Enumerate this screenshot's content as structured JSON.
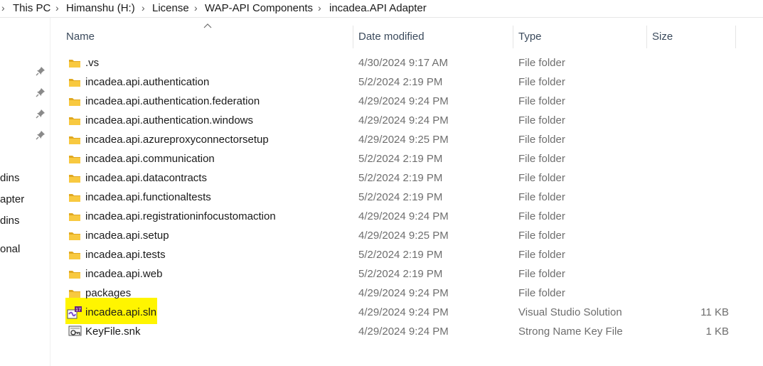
{
  "breadcrumb": {
    "items": [
      "This PC",
      "Himanshu (H:)",
      "License",
      "WAP-API Components",
      "incadea.API Adapter"
    ]
  },
  "nav_pane": {
    "labels": [
      "dins",
      "apter",
      "dins",
      "onal"
    ]
  },
  "columns": {
    "name": "Name",
    "date_modified": "Date modified",
    "type": "Type",
    "size": "Size"
  },
  "files": [
    {
      "name": ".vs",
      "date": "4/30/2024 9:17 AM",
      "type": "File folder",
      "size": "",
      "icon": "folder-icon"
    },
    {
      "name": "incadea.api.authentication",
      "date": "5/2/2024 2:19 PM",
      "type": "File folder",
      "size": "",
      "icon": "folder-icon"
    },
    {
      "name": "incadea.api.authentication.federation",
      "date": "4/29/2024 9:24 PM",
      "type": "File folder",
      "size": "",
      "icon": "folder-icon"
    },
    {
      "name": "incadea.api.authentication.windows",
      "date": "4/29/2024 9:24 PM",
      "type": "File folder",
      "size": "",
      "icon": "folder-icon"
    },
    {
      "name": "incadea.api.azureproxyconnectorsetup",
      "date": "4/29/2024 9:25 PM",
      "type": "File folder",
      "size": "",
      "icon": "folder-icon"
    },
    {
      "name": "incadea.api.communication",
      "date": "5/2/2024 2:19 PM",
      "type": "File folder",
      "size": "",
      "icon": "folder-icon"
    },
    {
      "name": "incadea.api.datacontracts",
      "date": "5/2/2024 2:19 PM",
      "type": "File folder",
      "size": "",
      "icon": "folder-icon"
    },
    {
      "name": "incadea.api.functionaltests",
      "date": "5/2/2024 2:19 PM",
      "type": "File folder",
      "size": "",
      "icon": "folder-icon"
    },
    {
      "name": "incadea.api.registrationinfocustomaction",
      "date": "4/29/2024 9:24 PM",
      "type": "File folder",
      "size": "",
      "icon": "folder-icon"
    },
    {
      "name": "incadea.api.setup",
      "date": "4/29/2024 9:25 PM",
      "type": "File folder",
      "size": "",
      "icon": "folder-icon"
    },
    {
      "name": "incadea.api.tests",
      "date": "5/2/2024 2:19 PM",
      "type": "File folder",
      "size": "",
      "icon": "folder-icon"
    },
    {
      "name": "incadea.api.web",
      "date": "5/2/2024 2:19 PM",
      "type": "File folder",
      "size": "",
      "icon": "folder-icon"
    },
    {
      "name": "packages",
      "date": "4/29/2024 9:24 PM",
      "type": "File folder",
      "size": "",
      "icon": "folder-icon"
    },
    {
      "name": "incadea.api.sln",
      "date": "4/29/2024 9:24 PM",
      "type": "Visual Studio Solution",
      "size": "11 KB",
      "icon": "visual-studio-solution-icon",
      "highlighted": true
    },
    {
      "name": "KeyFile.snk",
      "date": "4/29/2024 9:24 PM",
      "type": "Strong Name Key File",
      "size": "1 KB",
      "icon": "strong-name-key-icon"
    }
  ],
  "colors": {
    "folder": "#f8c940",
    "folder_dark": "#e0a820",
    "highlight": "#fff500",
    "secondary_text": "#6e6e6e"
  }
}
